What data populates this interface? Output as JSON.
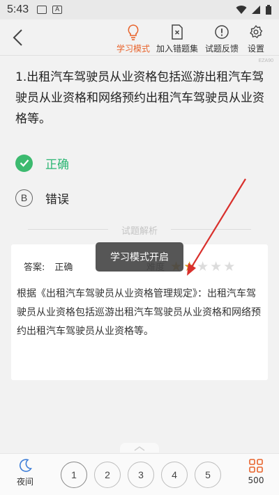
{
  "statusbar": {
    "time": "5:43",
    "icon_a": "A"
  },
  "toolbar": {
    "study_mode": "学习模式",
    "add_wrong": "加入错题集",
    "feedback": "试题反馈",
    "settings": "设置",
    "accent_color": "#e8632b"
  },
  "code": "EZA90",
  "question": {
    "text": "1.出租汽车驾驶员从业资格包括巡游出租汽车驾驶员从业资格和网络预约出租汽车驾驶员从业资格等。"
  },
  "options": [
    {
      "letter": "✓",
      "label": "正确",
      "state": "correct",
      "color": "#3cba6f"
    },
    {
      "letter": "B",
      "label": "错误",
      "state": "normal"
    }
  ],
  "analysis": {
    "section_label": "试题解析",
    "answer_label": "答案:",
    "answer_value": "正确",
    "difficulty_label": "难度",
    "difficulty_stars": 2,
    "difficulty_max": 5,
    "star_color": "#d99a1e",
    "text": "根据《出租汽车驾驶员从业资格管理规定》：出租汽车驾驶员从业资格包括巡游出租汽车驾驶员从业资格和网络预约出租汽车驾驶员从业资格等。"
  },
  "toast": "学习模式开启",
  "bottom": {
    "night": "夜间",
    "pages": [
      "1",
      "2",
      "3",
      "4",
      "5"
    ],
    "total": "500",
    "grid_color": "#e8632b"
  }
}
